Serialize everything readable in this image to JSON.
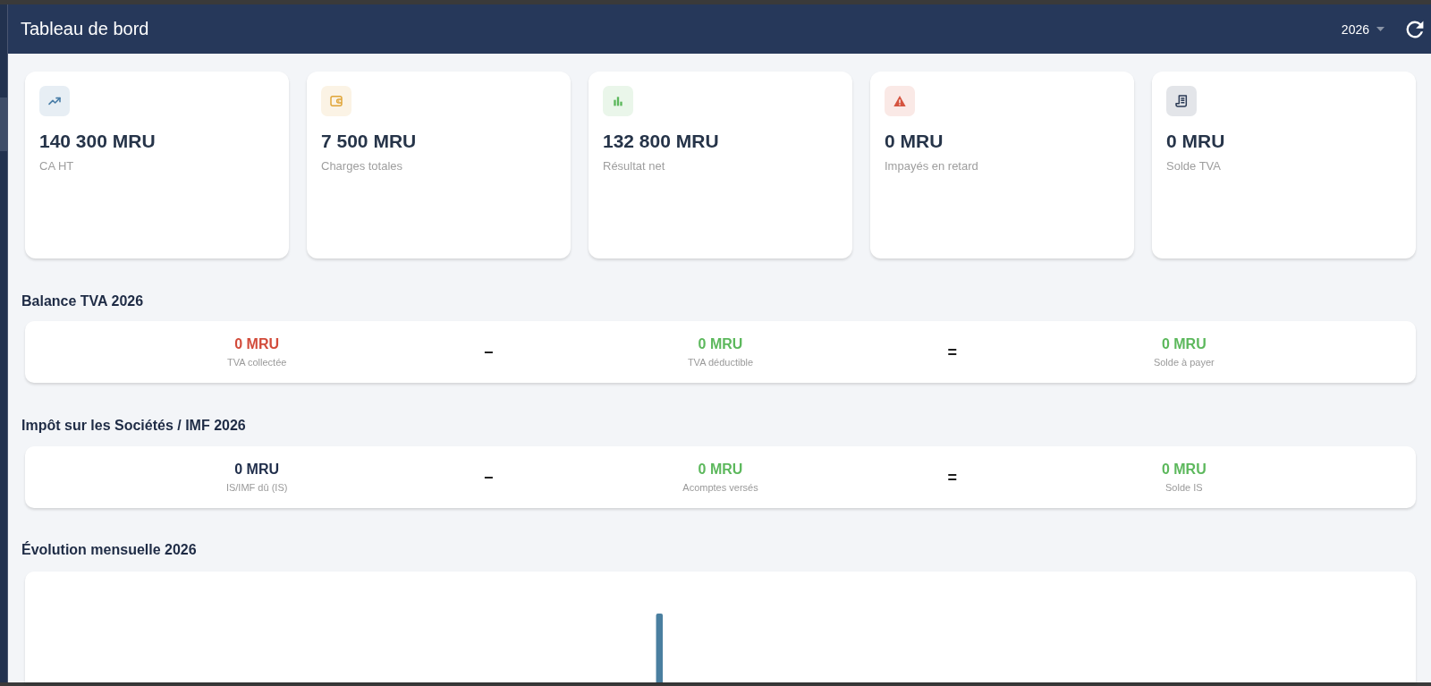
{
  "header": {
    "title": "Tableau de bord",
    "year_select": {
      "value": "2026"
    }
  },
  "kpis": [
    {
      "value": "140 300 MRU",
      "label": "CA HT",
      "color": "#4a7ea8"
    },
    {
      "value": "7 500 MRU",
      "label": "Charges totales",
      "color": "#e0a436"
    },
    {
      "value": "132 800 MRU",
      "label": "Résultat net",
      "color": "#5cb85c"
    },
    {
      "value": "0 MRU",
      "label": "Impayés en retard",
      "color": "#d5533f"
    },
    {
      "value": "0 MRU",
      "label": "Solde TVA",
      "color": "#2b3a55"
    }
  ],
  "balances": [
    {
      "title": "Balance TVA 2026",
      "items": [
        {
          "kind": "term",
          "value": "0 MRU",
          "label": "TVA collectée",
          "color": "#d24b3a"
        },
        {
          "kind": "operator",
          "symbol": "−"
        },
        {
          "kind": "term",
          "value": "0 MRU",
          "label": "TVA déductible",
          "color": "#5cb85c"
        },
        {
          "kind": "operator",
          "symbol": "="
        },
        {
          "kind": "term",
          "value": "0 MRU",
          "label": "Solde à payer",
          "color": "#5cb85c"
        }
      ]
    },
    {
      "title": "Impôt sur les Sociétés / IMF 2026",
      "items": [
        {
          "kind": "term",
          "value": "0 MRU",
          "label": "IS/IMF dû (IS)",
          "color": "#1f2d4a"
        },
        {
          "kind": "operator",
          "symbol": "−"
        },
        {
          "kind": "term",
          "value": "0 MRU",
          "label": "Acomptes versés",
          "color": "#5cb85c"
        },
        {
          "kind": "operator",
          "symbol": "="
        },
        {
          "kind": "term",
          "value": "0 MRU",
          "label": "Solde IS",
          "color": "#5cb85c"
        }
      ]
    }
  ],
  "monthly_chart": {
    "title": "Évolution mensuelle 2026"
  }
}
